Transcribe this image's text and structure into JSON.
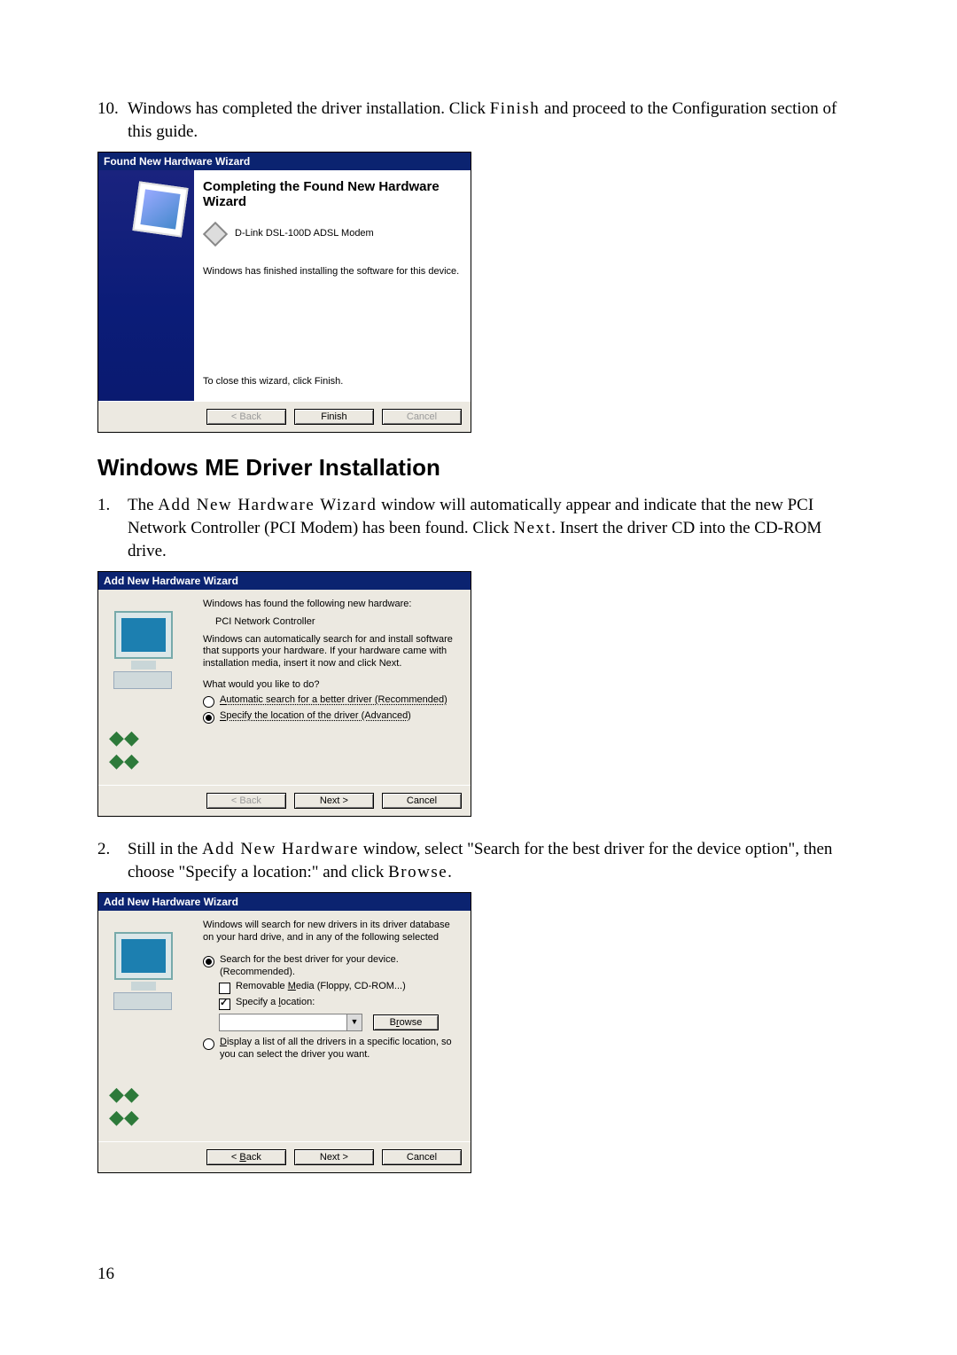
{
  "page_number": "16",
  "step10": {
    "num": "10.",
    "text_a": "Windows has completed the driver installation. Click ",
    "finish": "Finish",
    "text_b": " and proceed to the Configuration section of this guide."
  },
  "dlg1": {
    "title": "Found New Hardware Wizard",
    "heading": "Completing the Found New Hardware Wizard",
    "device": "D-Link DSL-100D ADSL Modem",
    "done": "Windows has finished installing the software for this device.",
    "close": "To close this wizard, click Finish.",
    "btn_back": "< Back",
    "btn_finish": "Finish",
    "btn_cancel": "Cancel"
  },
  "section_heading": "Windows ME Driver Installation",
  "step1": {
    "num": "1.",
    "text_a": "The ",
    "wizard": "Add New Hardware Wizard",
    "text_b": " window will automatically appear and indicate that the new PCI Network Controller (PCI Modem) has been found. Click ",
    "next": "Next",
    "text_c": ". Insert the driver CD into the CD-ROM drive."
  },
  "dlg2": {
    "title": "Add New Hardware Wizard",
    "found": "Windows has found the following new hardware:",
    "device": "PCI Network Controller",
    "autodesc": "Windows can automatically search for and install software that supports your hardware. If your hardware came with installation media, insert it now and click Next.",
    "what": "What would you like to do?",
    "opt_auto": "Automatic search for a better driver (Recommended)",
    "opt_spec": "Specify the location of the driver (Advanced)",
    "btn_back": "< Back",
    "btn_next": "Next >",
    "btn_cancel": "Cancel"
  },
  "step2": {
    "num": "2.",
    "text_a": "Still in the ",
    "wizard": "Add New Hardware",
    "text_b": " window, select \"Search for the best driver for the device option\", then choose \"Specify a location:\" and click ",
    "browse": "Browse",
    "text_c": "."
  },
  "dlg3": {
    "title": "Add New Hardware Wizard",
    "intro": "Windows will search for new drivers in its driver database on your hard drive, and in any of the following selected",
    "opt_search": "Search for the best driver for your device. (Recommended).",
    "chk_removable": "Removable Media (Floppy, CD-ROM...)",
    "chk_specify": "Specify a location:",
    "btn_browse": "Browse",
    "opt_display": "Display a list of all the drivers in a specific location, so you can select the driver you want.",
    "btn_back": "< Back",
    "btn_next": "Next >",
    "btn_cancel": "Cancel"
  },
  "underline_chars": {
    "A": "A",
    "S": "S",
    "M": "M",
    "l": "l",
    "D": "D",
    "B": "B",
    "r": "r"
  }
}
